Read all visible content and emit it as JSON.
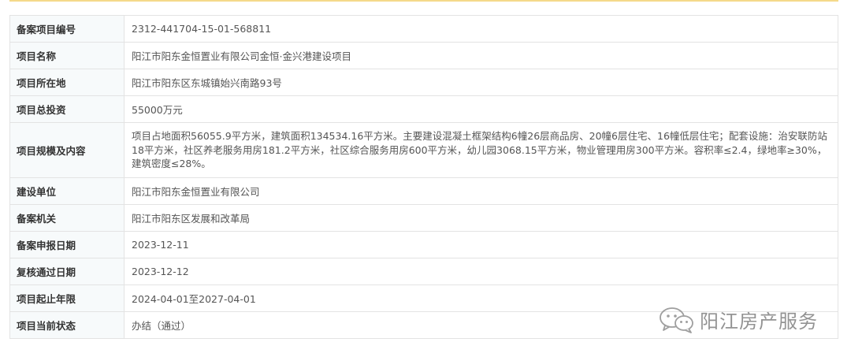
{
  "rows": [
    {
      "label": "备案项目编号",
      "value": "2312-441704-15-01-568811"
    },
    {
      "label": "项目名称",
      "value": "阳江市阳东金恒置业有限公司金恒·金兴港建设项目"
    },
    {
      "label": "项目所在地",
      "value": "阳江市阳东区东城镇始兴南路93号"
    },
    {
      "label": "项目总投资",
      "value": "55000万元"
    },
    {
      "label": "项目规模及内容",
      "value": "项目占地面积56055.9平方米，建筑面积134534.16平方米。主要建设混凝土框架结构6幢26层商品房、20幢6层住宅、16幢低层住宅；配套设施：治安联防站18平方米，社区养老服务用房181.2平方米，社区综合服务用房600平方米，幼儿园3068.15平方米，物业管理用房300平方米。容积率≤2.4，绿地率≥30%，建筑密度≤28%。"
    },
    {
      "label": "建设单位",
      "value": "阳江市阳东金恒置业有限公司"
    },
    {
      "label": "备案机关",
      "value": "阳江市阳东区发展和改革局"
    },
    {
      "label": "备案申报日期",
      "value": "2023-12-11"
    },
    {
      "label": "复核通过日期",
      "value": "2023-12-12"
    },
    {
      "label": "项目起止年限",
      "value": "2024-04-01至2027-04-01"
    },
    {
      "label": "项目当前状态",
      "value": "办结（通过）"
    }
  ],
  "watermark": {
    "text": "阳江房产服务",
    "icon": "wechat-icon"
  }
}
